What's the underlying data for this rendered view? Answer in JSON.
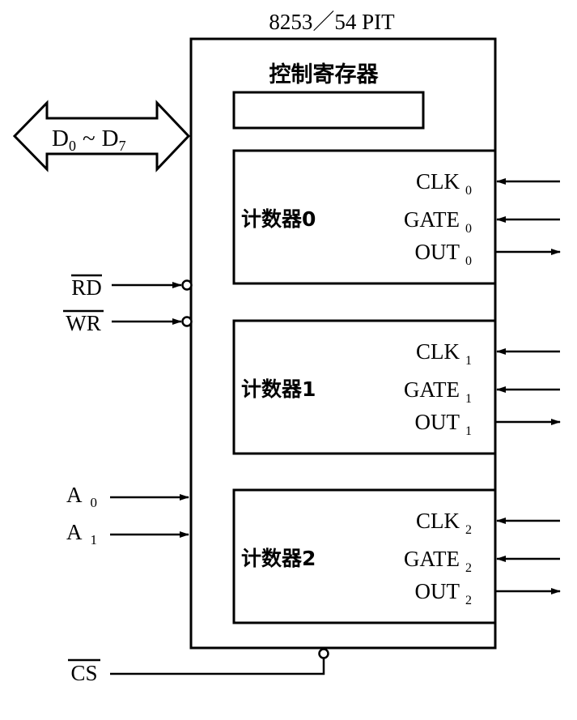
{
  "chip_title": "8253／54  PIT",
  "control_register_label": "控制寄存器",
  "data_bus": {
    "main": "D",
    "from_sub": "0",
    "tilde": "~",
    "to_main": "D",
    "to_sub": "7"
  },
  "signals": {
    "rd": "RD",
    "wr": "WR",
    "a0": "A",
    "a0_sub": "0",
    "a1": "A",
    "a1_sub": "1",
    "cs": "CS"
  },
  "counters": [
    {
      "label": "计数器0",
      "clk": "CLK",
      "gate": "GATE",
      "out": "OUT",
      "sub": "0"
    },
    {
      "label": "计数器1",
      "clk": "CLK",
      "gate": "GATE",
      "out": "OUT",
      "sub": "1"
    },
    {
      "label": "计数器2",
      "clk": "CLK",
      "gate": "GATE",
      "out": "OUT",
      "sub": "2"
    }
  ]
}
